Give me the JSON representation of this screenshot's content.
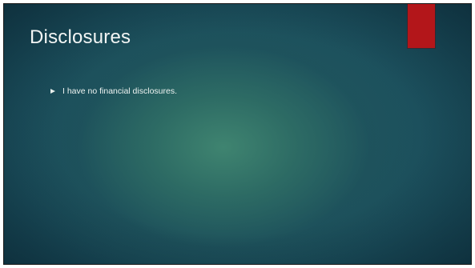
{
  "slide": {
    "title": "Disclosures",
    "bullets": [
      {
        "text": "I have no financial disclosures.",
        "icon": "triangle-bullet-icon"
      }
    ],
    "accent_color": "#b3161a",
    "background_color": "#1a4c5a"
  }
}
